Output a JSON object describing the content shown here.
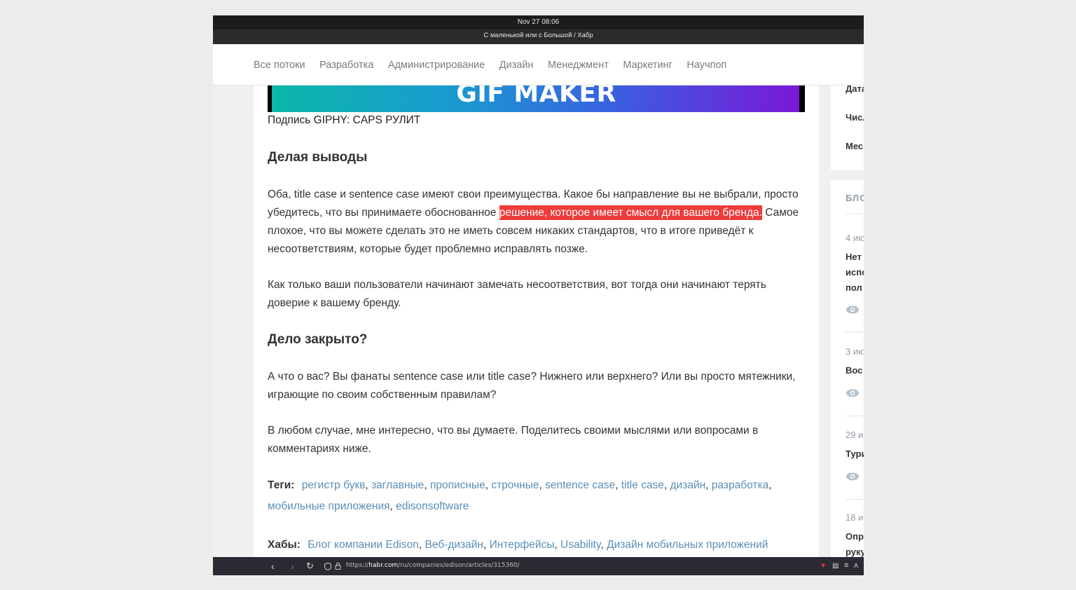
{
  "os": {
    "datetime": "Nov 27  08:06"
  },
  "window": {
    "title": "С маленькой или с Большой / Хабр"
  },
  "nav": {
    "items": [
      "Все потоки",
      "Разработка",
      "Администрирование",
      "Дизайн",
      "Менеджмент",
      "Маркетинг",
      "Научпоп"
    ]
  },
  "article": {
    "banner_text": "GIF MAKER",
    "caption": "Подпись GIPHY: CAPS РУЛИТ",
    "h_conclusions": "Делая выводы",
    "p1_before": "Оба, title case и sentence case имеют свои преимущества. Какое бы направление вы не выбрали, просто убедитесь, что вы принимаете обоснованное ",
    "p1_highlight": "решение, которое имеет смысл для вашего бренда.",
    "p1_after": " Самое плохое, что вы можете сделать это не иметь совсем никаких стандартов, что в итоге приведёт к несоответствиям, которые будет проблемно исправлять позже.",
    "p2": "Как только ваши пользователи начинают замечать несоответствия, вот тогда они начинают терять доверие к вашему бренду.",
    "h_closed": "Дело закрыто?",
    "p3": "А что о вас? Вы фанаты sentence case или title case? Нижнего или верхнего? Или вы просто мятежники, играющие по своим собственным правилам?",
    "p4": "В любом случае, мне интересно, что вы думаете. Поделитесь своими мыслями или вопросами в комментариях ниже.",
    "tags_label": "Теги:",
    "tags": [
      "регистр букв",
      "заглавные",
      "прописные",
      "строчные",
      "sentence case",
      "title case",
      "дизайн",
      "разработка",
      "мобильные приложения",
      "edisonsoftware"
    ],
    "hubs_label": "Хабы:",
    "hubs": [
      "Блог компании Edison",
      "Веб-дизайн",
      "Интерфейсы",
      "Usability",
      "Дизайн мобильных приложений"
    ]
  },
  "sidebar": {
    "top_rows": [
      "Дата",
      "Числ",
      "Мес"
    ],
    "blog_header": "БЛО",
    "posts": [
      {
        "date": "4 ию",
        "title_lines": [
          "Нет",
          "испо",
          "пол"
        ]
      },
      {
        "date": "3 ию",
        "title_lines": [
          "Вос"
        ]
      },
      {
        "date": "29 и",
        "title_lines": [
          "Тури"
        ]
      },
      {
        "date": "18 и",
        "title_lines": [
          "Опр",
          "руку"
        ]
      }
    ]
  },
  "browser": {
    "url_prefix": "https://",
    "url_host": "habr.com",
    "url_path": "/ru/companies/edison/articles/315360/"
  },
  "colors": {
    "highlight": "#ee3b3b",
    "link": "#5a8fb8",
    "nav_text": "#7b7b7b"
  }
}
